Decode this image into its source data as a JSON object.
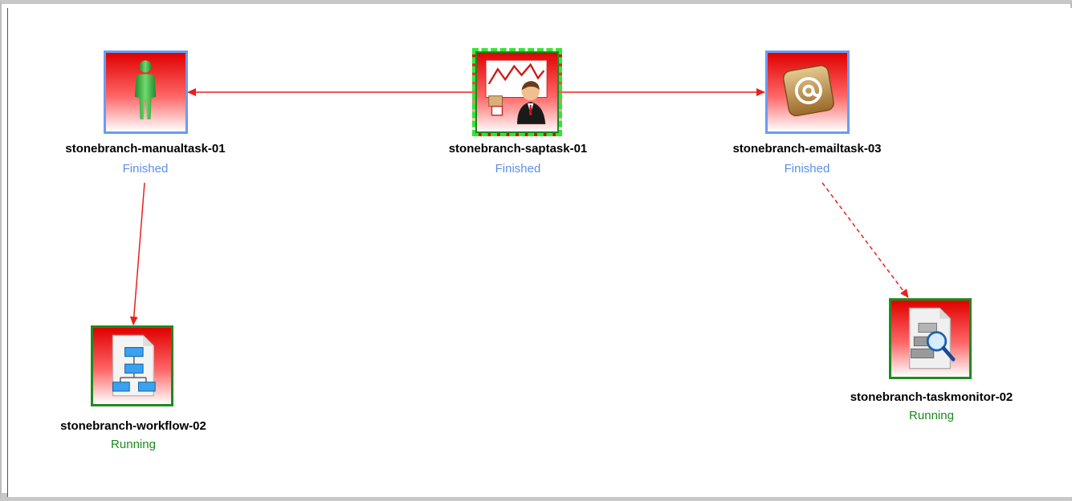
{
  "diagram": {
    "nodes": [
      {
        "id": "manualtask",
        "label": "stonebranch-manualtask-01",
        "status": "Finished",
        "icon": "person-icon"
      },
      {
        "id": "saptask",
        "label": "stonebranch-saptask-01",
        "status": "Finished",
        "icon": "sap-businessman-icon",
        "selected": true
      },
      {
        "id": "emailtask",
        "label": "stonebranch-emailtask-03",
        "status": "Finished",
        "icon": "email-at-icon"
      },
      {
        "id": "workflow",
        "label": "stonebranch-workflow-02",
        "status": "Running",
        "icon": "workflow-document-icon"
      },
      {
        "id": "taskmonitor",
        "label": "stonebranch-taskmonitor-02",
        "status": "Running",
        "icon": "task-monitor-magnifier-icon"
      }
    ],
    "edges": [
      {
        "from": "saptask",
        "to": "manualtask",
        "style": "solid"
      },
      {
        "from": "saptask",
        "to": "emailtask",
        "style": "solid"
      },
      {
        "from": "manualtask",
        "to": "workflow",
        "style": "solid"
      },
      {
        "from": "emailtask",
        "to": "taskmonitor",
        "style": "dashed"
      }
    ],
    "colors": {
      "edge": "#e8211d",
      "finished": "#5b8fe8",
      "running": "#1a8a1a",
      "node_border_finished": "#6a9cf2",
      "node_border_running": "#1f8a1f",
      "selection": "#36e436"
    }
  }
}
